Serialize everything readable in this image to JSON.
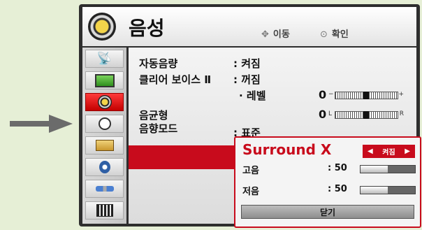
{
  "header": {
    "title": "음성",
    "hint_move_icon": "dpad-icon",
    "hint_move_label": "이동",
    "hint_ok_icon": "ok-button-icon",
    "hint_ok_label": "확인"
  },
  "sidebar": {
    "items": [
      {
        "name": "satellite-icon",
        "glyph": "📡",
        "active": false
      },
      {
        "name": "tv-screen-icon",
        "glyph": "🖥",
        "active": false
      },
      {
        "name": "speaker-icon",
        "glyph": "◉",
        "active": true
      },
      {
        "name": "clock-icon",
        "glyph": "🕒",
        "active": false
      },
      {
        "name": "toolbox-icon",
        "glyph": "🧰",
        "active": false
      },
      {
        "name": "lock-icon",
        "glyph": "🔒",
        "active": false
      },
      {
        "name": "cable-icon",
        "glyph": "🔌",
        "active": false
      },
      {
        "name": "film-icon",
        "glyph": "🎬",
        "active": false
      }
    ]
  },
  "menu": {
    "auto_volume_label": "자동음량",
    "auto_volume_value": ": 켜짐",
    "clear_voice_label": "클리어 보이스 Ⅱ",
    "clear_voice_value": ": 꺼짐",
    "level_label": "· 레벨",
    "level_value": "0",
    "balance_label": "음균형",
    "balance_value": "0",
    "sound_mode_label": "음향모드",
    "sound_mode_value": ": 표준"
  },
  "popup": {
    "title": "Surround X",
    "toggle_value": "켜짐",
    "treble_label": "고음",
    "treble_value": ": 50",
    "treble_level": 50,
    "bass_label": "저음",
    "bass_value": ": 50",
    "bass_level": 50,
    "close_label": "닫기"
  },
  "colors": {
    "accent": "#c80b1c",
    "background": "#e6efd6",
    "frame": "#2e2e2e"
  }
}
